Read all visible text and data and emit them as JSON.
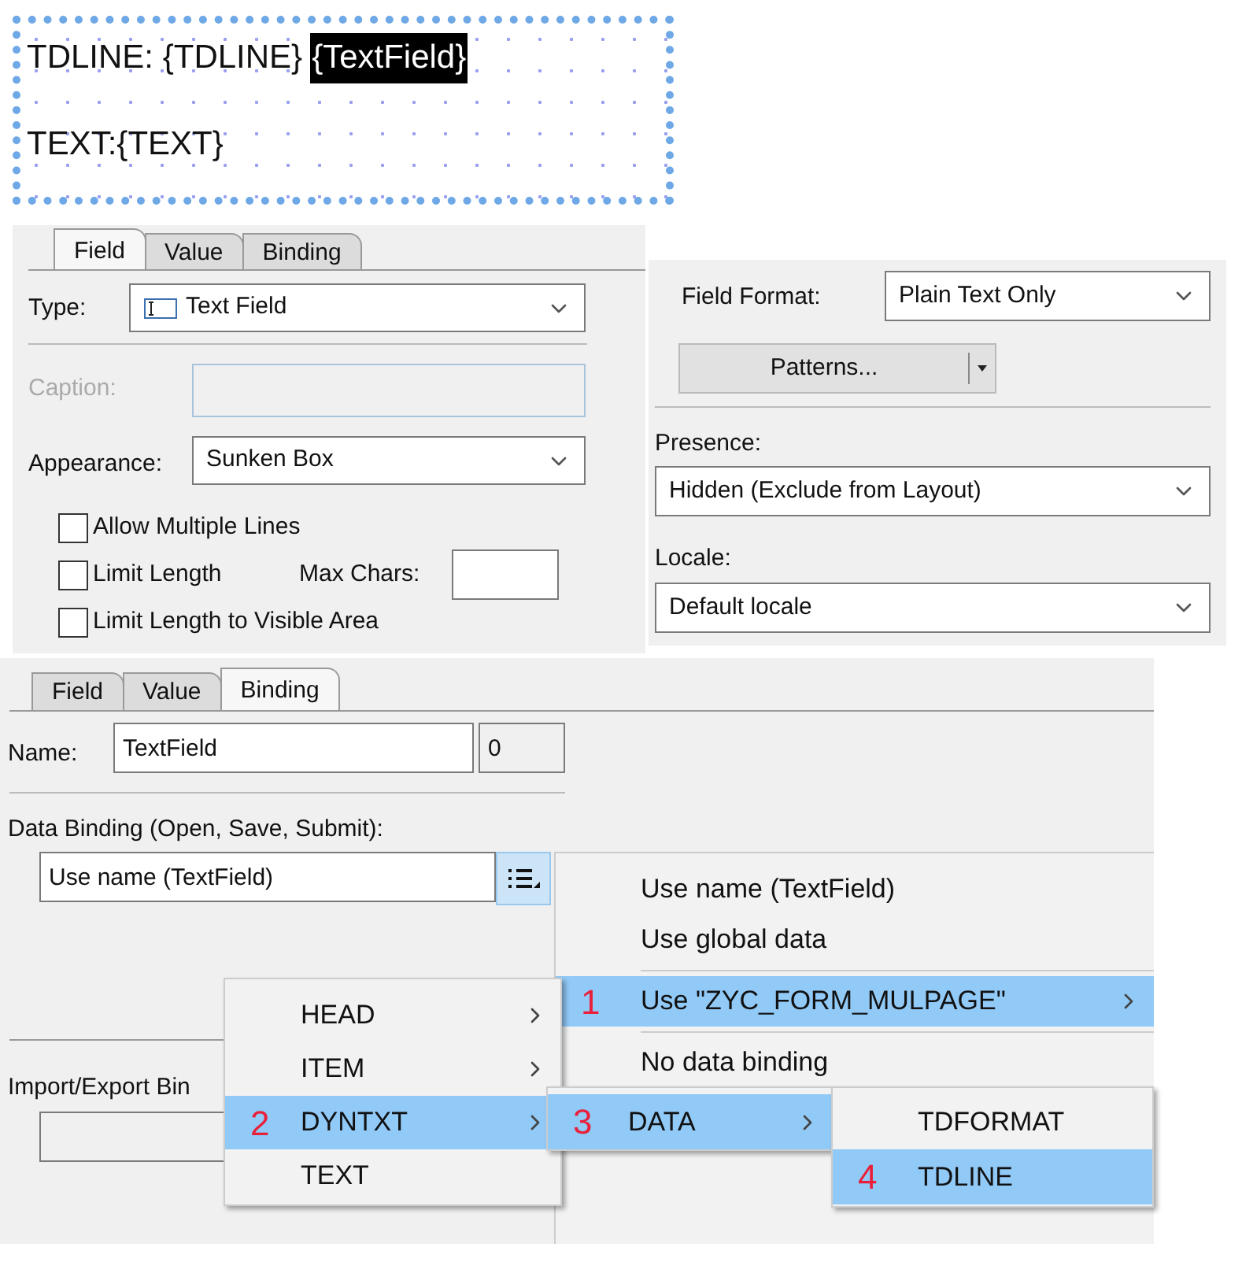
{
  "design_canvas": {
    "line_1": "TDLINE: {TDLINE}",
    "selected_field": "{TextField}",
    "line_2": "TEXT:{TEXT}"
  },
  "field_panel": {
    "tabs": [
      {
        "label": "Field",
        "selected": true
      },
      {
        "label": "Value",
        "selected": false
      },
      {
        "label": "Binding",
        "selected": false
      }
    ],
    "type": {
      "label": "Type:",
      "value": "Text Field"
    },
    "caption": {
      "label": "Caption:",
      "disabled": true
    },
    "appearance": {
      "label": "Appearance:",
      "value": "Sunken Box"
    },
    "checkboxes": [
      {
        "label": "Allow Multiple Lines",
        "checked": false
      },
      {
        "label": "Limit Length",
        "checked": false
      },
      {
        "label": "Limit Length to Visible Area",
        "checked": false
      }
    ],
    "max_chars_label": "Max Chars:"
  },
  "format_panel": {
    "field_format": {
      "label": "Field Format:",
      "value": "Plain Text Only"
    },
    "patterns_button": "Patterns...",
    "presence": {
      "label": "Presence:",
      "value": "Hidden (Exclude from Layout)"
    },
    "locale": {
      "label": "Locale:",
      "value": "Default locale"
    }
  },
  "binding_panel": {
    "tabs": [
      {
        "label": "Field",
        "selected": false
      },
      {
        "label": "Value",
        "selected": false
      },
      {
        "label": "Binding",
        "selected": true
      }
    ],
    "name": {
      "label": "Name:",
      "value": "TextField",
      "index": "0"
    },
    "data_binding": {
      "label": "Data Binding (Open, Save, Submit):",
      "value": "Use name (TextField)"
    },
    "import_export_label": "Import/Export Bin"
  },
  "menus": [
    {
      "items": [
        {
          "kind": "item",
          "label": "Use name (TextField)",
          "selected": false,
          "submenu": false
        },
        {
          "kind": "item",
          "label": "Use global data",
          "selected": false,
          "submenu": false
        },
        {
          "kind": "separator"
        },
        {
          "kind": "item",
          "label": "Use \"ZYC_FORM_MULPAGE\"",
          "selected": true,
          "submenu": true,
          "marker": "1"
        },
        {
          "kind": "separator"
        },
        {
          "kind": "item",
          "label": "No data binding",
          "selected": false,
          "submenu": false
        }
      ]
    },
    {
      "items": [
        {
          "kind": "item",
          "label": "HEAD",
          "selected": false,
          "submenu": true
        },
        {
          "kind": "item",
          "label": "ITEM",
          "selected": false,
          "submenu": true
        },
        {
          "kind": "item",
          "label": "DYNTXT",
          "selected": true,
          "submenu": true,
          "marker": "2"
        },
        {
          "kind": "item",
          "label": "TEXT",
          "selected": false,
          "submenu": false
        }
      ]
    },
    {
      "items": [
        {
          "kind": "item",
          "label": "DATA",
          "selected": true,
          "submenu": true,
          "marker": "3"
        }
      ]
    },
    {
      "items": [
        {
          "kind": "item",
          "label": "TDFORMAT",
          "selected": false,
          "submenu": false
        },
        {
          "kind": "item",
          "label": "TDLINE",
          "selected": true,
          "submenu": false,
          "marker": "4"
        }
      ]
    }
  ]
}
